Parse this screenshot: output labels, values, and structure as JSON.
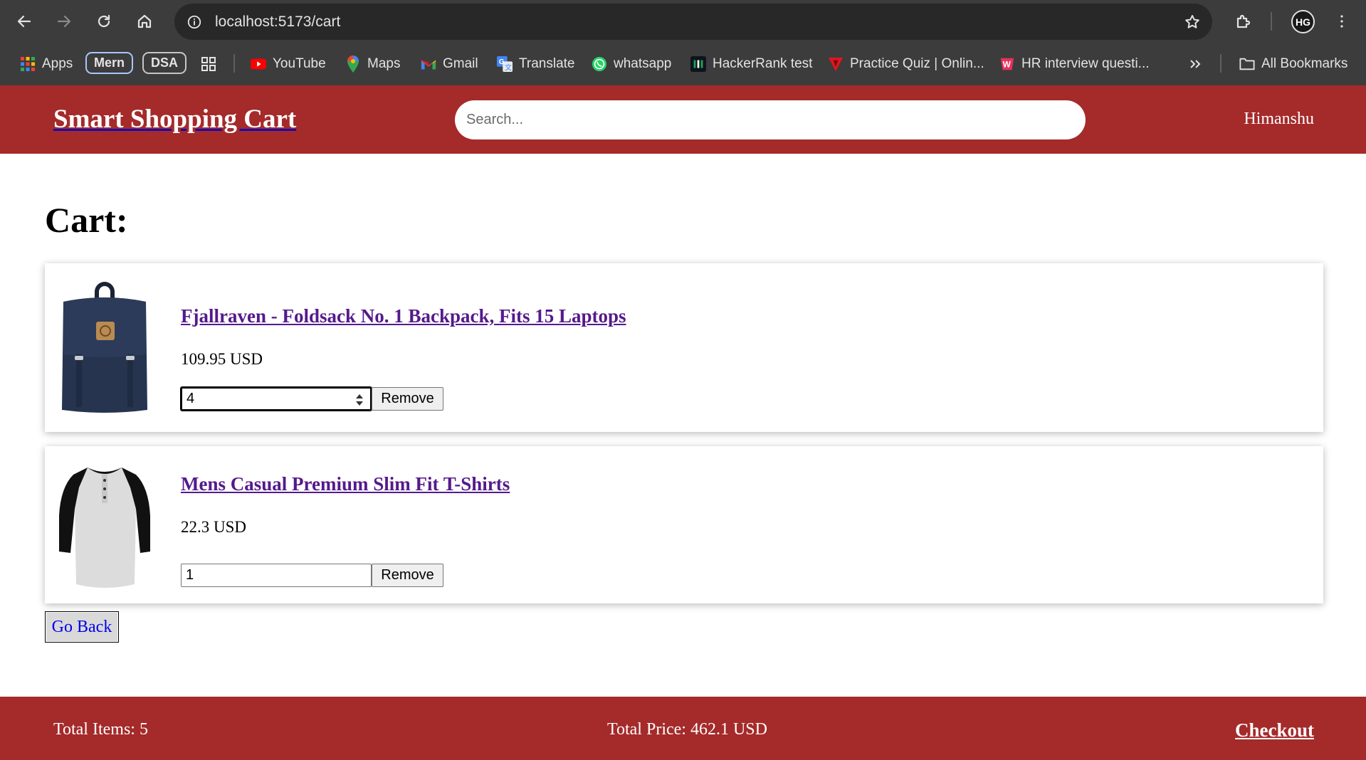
{
  "browser": {
    "url": "localhost:5173/cart",
    "bookmarks": {
      "apps": "Apps",
      "mern": "Mern",
      "dsa": "DSA",
      "youtube": "YouTube",
      "maps": "Maps",
      "gmail": "Gmail",
      "translate": "Translate",
      "whatsapp": "whatsapp",
      "hackerrank": "HackerRank test",
      "practice_quiz": "Practice Quiz | Onlin...",
      "hr_interview": "HR interview questi...",
      "all_bookmarks": "All Bookmarks"
    },
    "profile_initials": "HG"
  },
  "header": {
    "brand": "Smart Shopping Cart",
    "search_placeholder": "Search...",
    "user_name": "Himanshu"
  },
  "cart": {
    "heading": "Cart:",
    "items": [
      {
        "title": "Fjallraven - Foldsack No. 1 Backpack, Fits 15 Laptops",
        "price": "109.95 USD",
        "quantity": "4",
        "remove_label": "Remove"
      },
      {
        "title": "Mens Casual Premium Slim Fit T-Shirts",
        "price": "22.3 USD",
        "quantity": "1",
        "remove_label": "Remove"
      }
    ],
    "go_back_label": "Go Back"
  },
  "footer": {
    "total_items": "Total Items: 5",
    "total_price": "Total Price: 462.1 USD",
    "checkout_label": "Checkout"
  },
  "colors": {
    "brand_red": "#a52a2a",
    "chrome_bg": "#3c3c3c",
    "visited_link": "#551a8b"
  }
}
